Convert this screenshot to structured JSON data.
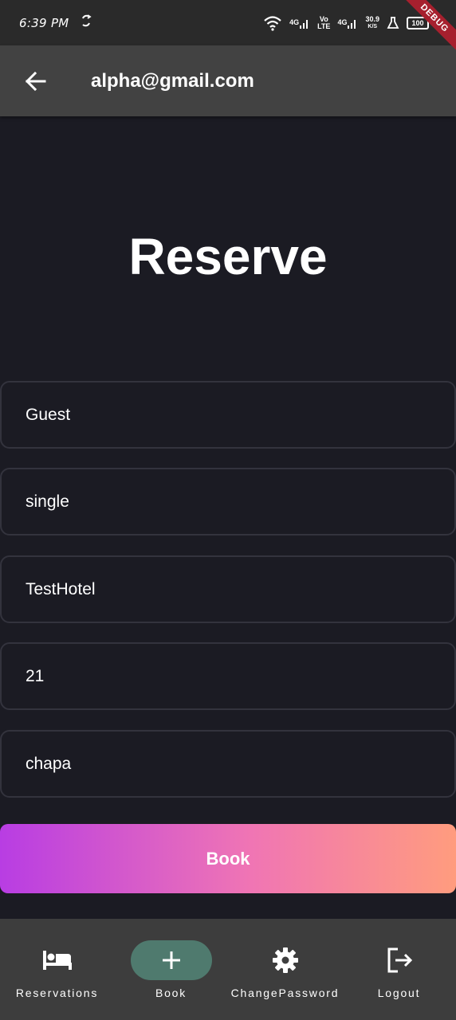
{
  "status_bar": {
    "time": "6:39 PM",
    "net1": "4G",
    "volte_top": "Vo",
    "volte_bottom": "LTE",
    "net2": "4G",
    "speed_top": "30.9",
    "speed_bottom": "K/S",
    "battery": "100"
  },
  "debug_banner": "DEBUG",
  "app_bar": {
    "back_icon": "arrow-back-icon",
    "title": "alpha@gmail.com"
  },
  "page": {
    "heading": "Reserve"
  },
  "form": {
    "guest": "Guest",
    "room_type": "single",
    "hotel": "TestHotel",
    "number": "21",
    "payment": "chapa"
  },
  "book_button": {
    "label": "Book",
    "gradient": [
      "#b83de3",
      "#f075b4",
      "#ff9c7e"
    ]
  },
  "bottom_nav": {
    "items": [
      {
        "label": "Reservations",
        "icon": "bed-icon"
      },
      {
        "label": "Book",
        "icon": "plus-icon",
        "active": true
      },
      {
        "label": "ChangePassword",
        "icon": "gear-icon"
      },
      {
        "label": "Logout",
        "icon": "logout-icon"
      }
    ],
    "active_color": "#4f7a6e"
  }
}
